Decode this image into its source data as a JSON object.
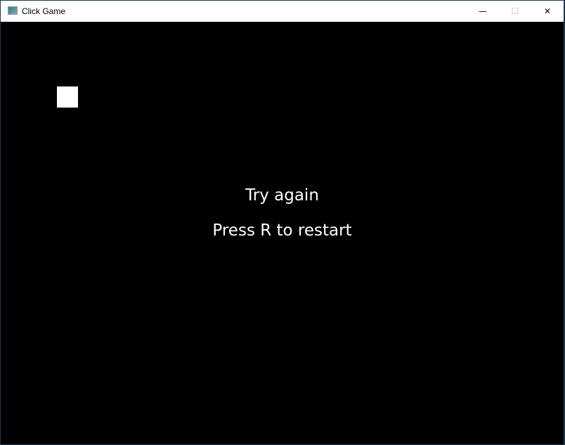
{
  "window": {
    "title": "Click Game",
    "minimize": "—",
    "maximize": "☐",
    "close": "✕"
  },
  "game": {
    "message": "Try again",
    "instruction": "Press R to restart",
    "target_color": "#ffffff"
  }
}
